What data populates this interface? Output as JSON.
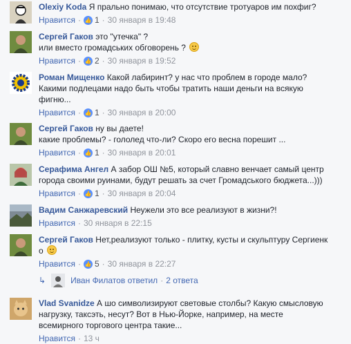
{
  "like_label": "Нравится",
  "separator": "·",
  "like_icon": "thumbs-up-icon",
  "comments": [
    {
      "author": "Olexiy Koda",
      "text": "Я прально понимаю, что отсутствие тротуаров им похфиг?",
      "likes": "1",
      "time": "30 января в 19:48"
    },
    {
      "author": "Сергей Гаков",
      "text": "это \"утечка\" ?\nили вместо громадських обговорень ?",
      "likes": "2",
      "time": "30 января в 19:52"
    },
    {
      "author": "Роман Мищенко",
      "text": "Какой лабиринт? у нас что проблем в городе мало?\nКакими подлецами надо быть чтобы тратить наши деньги на всякую\nфигню...",
      "likes": "1",
      "time": "30 января в 20:00"
    },
    {
      "author": "Сергей Гаков",
      "text": "ну вы даете!\nкакие проблемы? - гололед что-ли? Скоро его весна порешит ...",
      "likes": "1",
      "time": "30 января в 20:01"
    },
    {
      "author": "Серафима Ангел",
      "text": "А забор ОШ №5, который славно венчает самый центр\nгорода своими руинами, будут решать за счет Громадського бюджета...)))",
      "likes": "1",
      "time": "30 января в 20:04"
    },
    {
      "author": "Вадим Санжаревский",
      "text": "Неужели это все реализуют в жизни?!",
      "likes": "",
      "time": "30 января в 22:15"
    },
    {
      "author": "Сергей Гаков",
      "text": "Нет,реализуют только - плитку, кусты и скульптуру Сергиенк\nо",
      "likes": "5",
      "time": "30 января в 22:27"
    },
    {
      "author": "Vlad Svanidze",
      "text": "А шо символизируют световые столбы? Какую смысловую\nнагрузку, таксэть, несут? Вот в Нью-Йорке, например, на месте\nвсемирного торгового центра такие...",
      "likes": "",
      "time": "13 ч"
    }
  ],
  "reply_summary": {
    "name": "Иван Филатов",
    "action": "ответил",
    "count": "2 ответа"
  }
}
